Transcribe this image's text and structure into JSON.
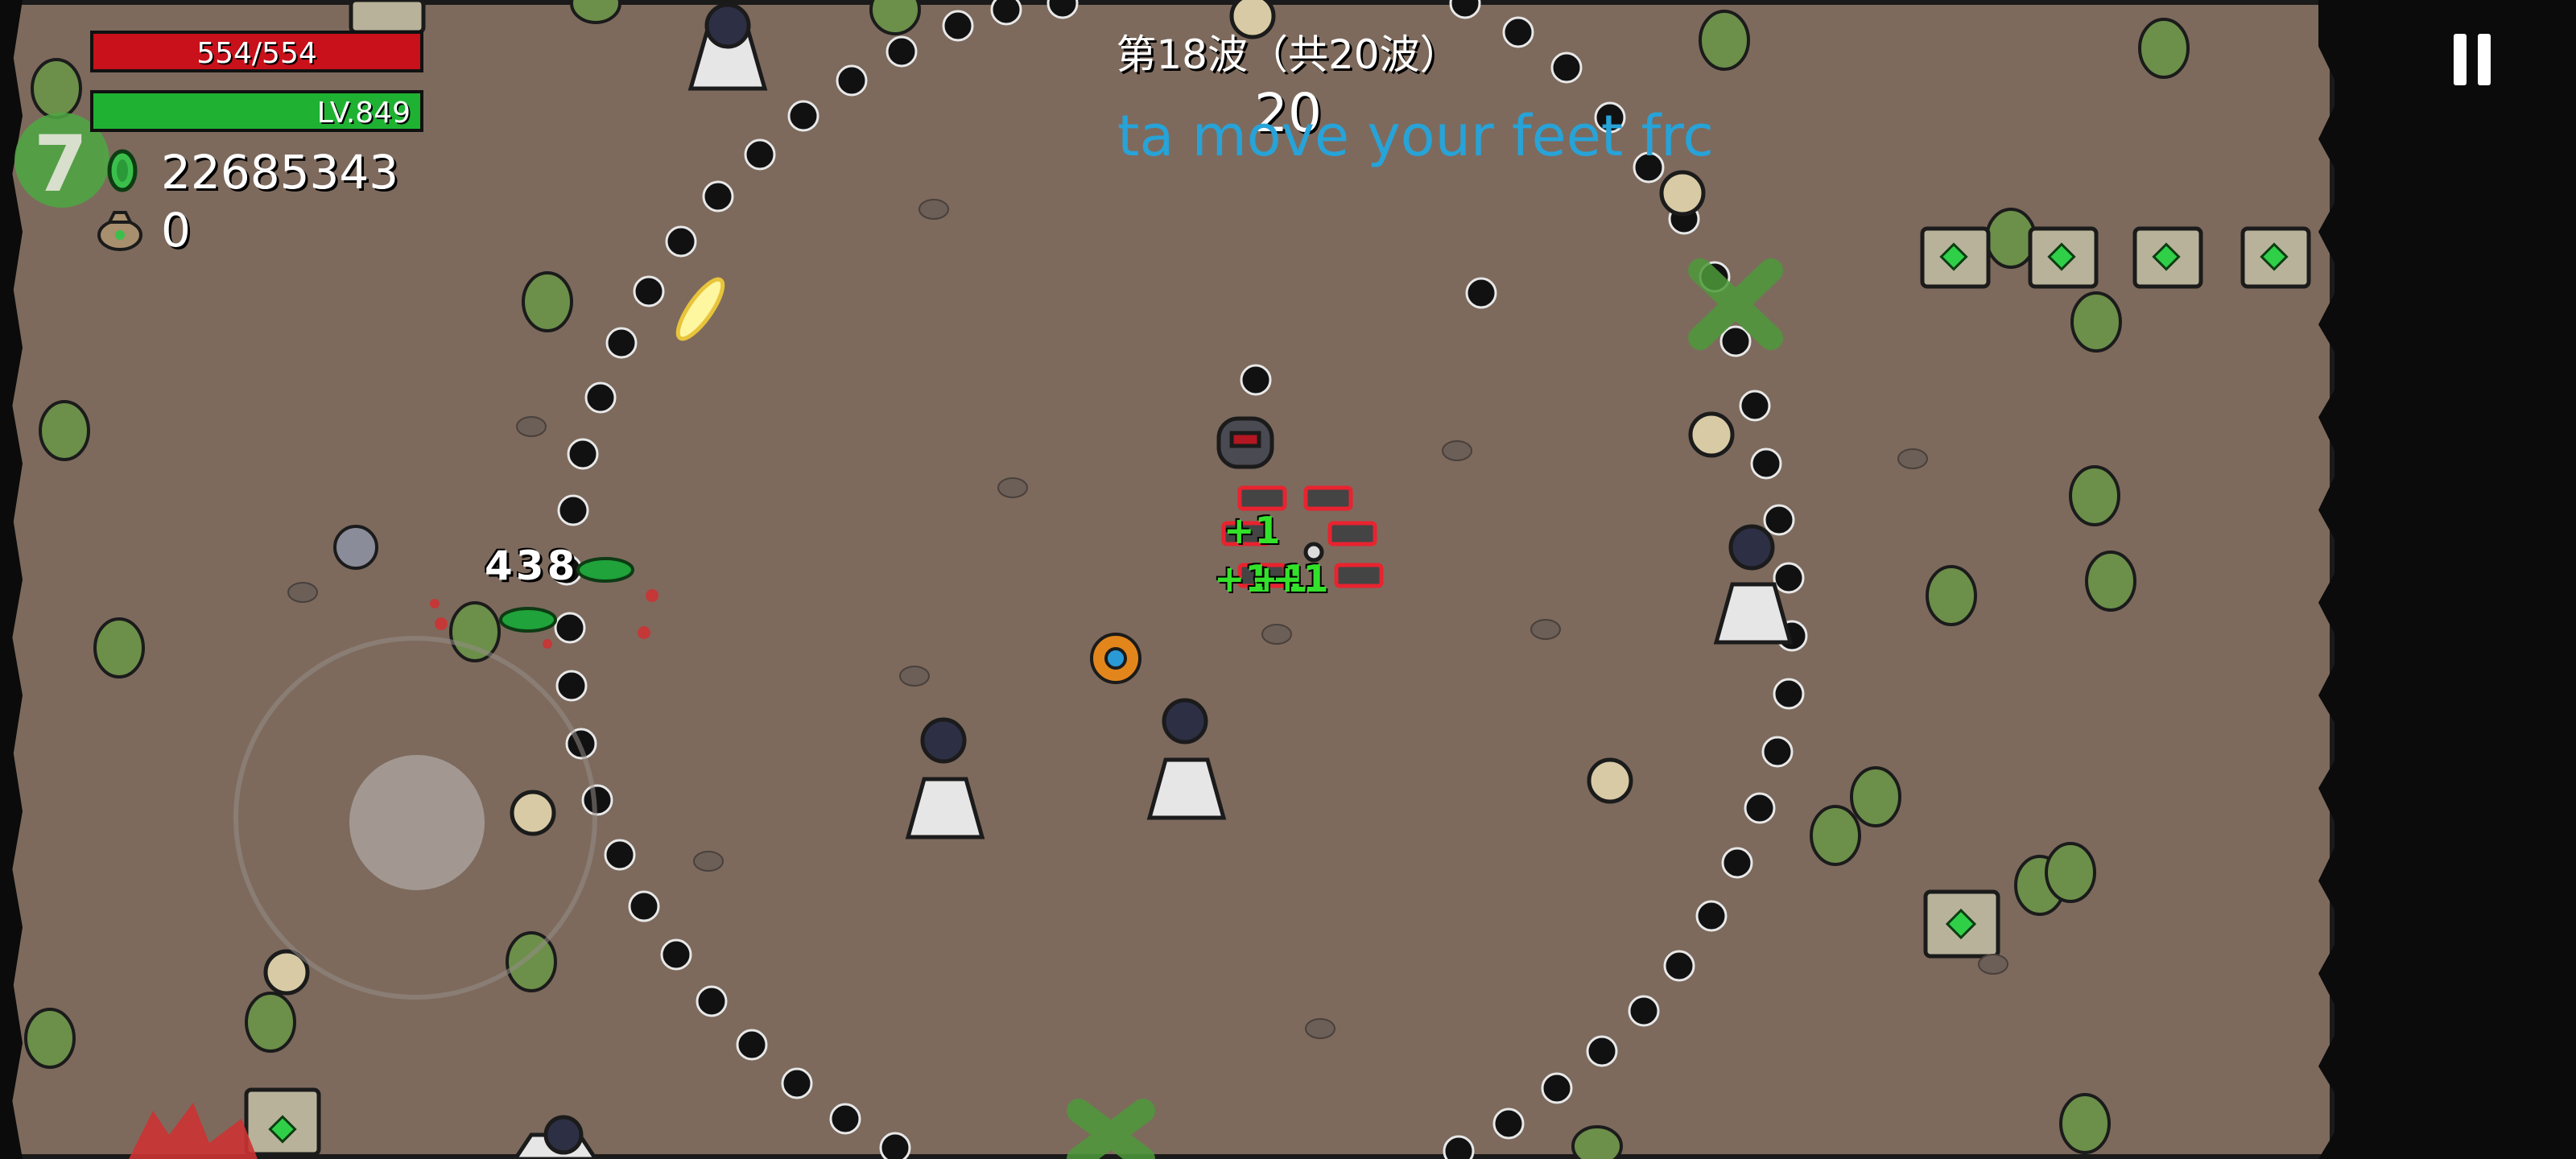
{
  "hud": {
    "hp_text": "554/554",
    "xp_text": "LV.849",
    "coins": "22685343",
    "bag": "0",
    "logo": "7"
  },
  "wave": {
    "label": "第18波（共20波）",
    "timer": "20"
  },
  "scroll_text": "ta move your feet frc",
  "combat": {
    "damage_number": "438",
    "pickups": [
      "+1",
      "+1",
      "+1",
      "+1"
    ]
  },
  "controls": {
    "pause_icon": "pause-icon",
    "joystick": "virtual-joystick"
  },
  "colors": {
    "ground": "#7d6a5d",
    "hp": "#c8111a",
    "xp": "#1fb232",
    "accent_text": "#27a3d8"
  }
}
